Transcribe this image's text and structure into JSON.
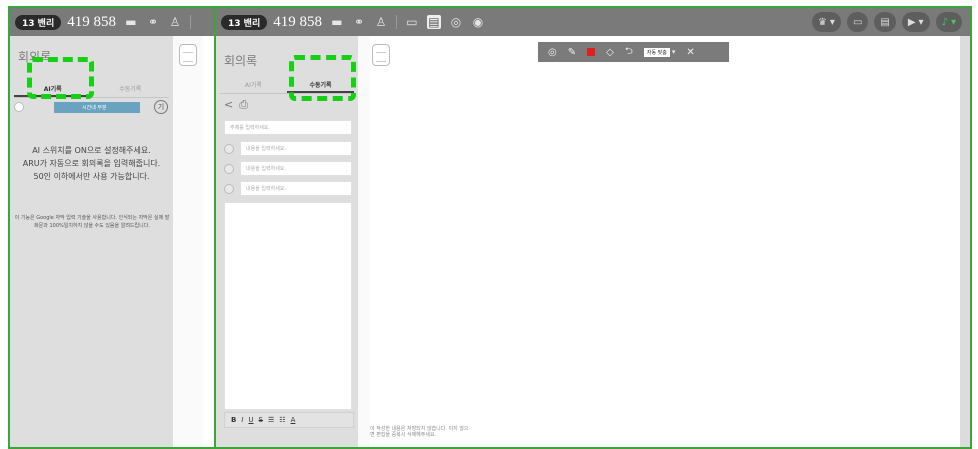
{
  "topbar": {
    "badge": "13 밴리",
    "number": "419 858",
    "front_badge": "13 밴리",
    "front_number": "419 858"
  },
  "back": {
    "title": "회의록",
    "tab_ai": "AI기록",
    "tab_manual": "수동기록",
    "badge_label": "시간내 부분",
    "badge_right": "기",
    "info": "AI 스위치를 ON으로 설정해주세요.\nARU가 자동으로 회의록을 입력해줍니다.\n50인 이하에서만 사용 가능합니다.",
    "notice": "이 기능은 Google 자막 입력 기술을 사용합니다. 인식되는 자막은 실제 발화문과 100%일치하지 않을 수도 있음을 알려드립니다."
  },
  "front": {
    "title": "회의록",
    "tab_ai": "AI기록",
    "tab_manual": "수동기록",
    "subject_placeholder": "주제를 입력하세요.",
    "item_placeholder_1": "내용을 입력하세요.",
    "item_placeholder_2": "내용을 입력하세요.",
    "item_placeholder_3": "내용을 입력하세요.",
    "footer_note": "이 작성한 내용은 저장되지 않습니다. 이지 않으면 편집을 중복시 삭제해주세요.",
    "editor_bold": "B",
    "editor_italic": "I",
    "editor_underline": "U",
    "editor_strike": "S",
    "editor_font": "A"
  },
  "float_toolbar": {
    "select_label": "자동 맞춤",
    "close": "✕"
  },
  "icons": {
    "bed": "bed-icon",
    "lock": "lock-icon",
    "person": "person-icon",
    "monitor": "monitor-icon",
    "doc": "document-icon",
    "camera": "camera-icon",
    "record": "record-icon"
  }
}
